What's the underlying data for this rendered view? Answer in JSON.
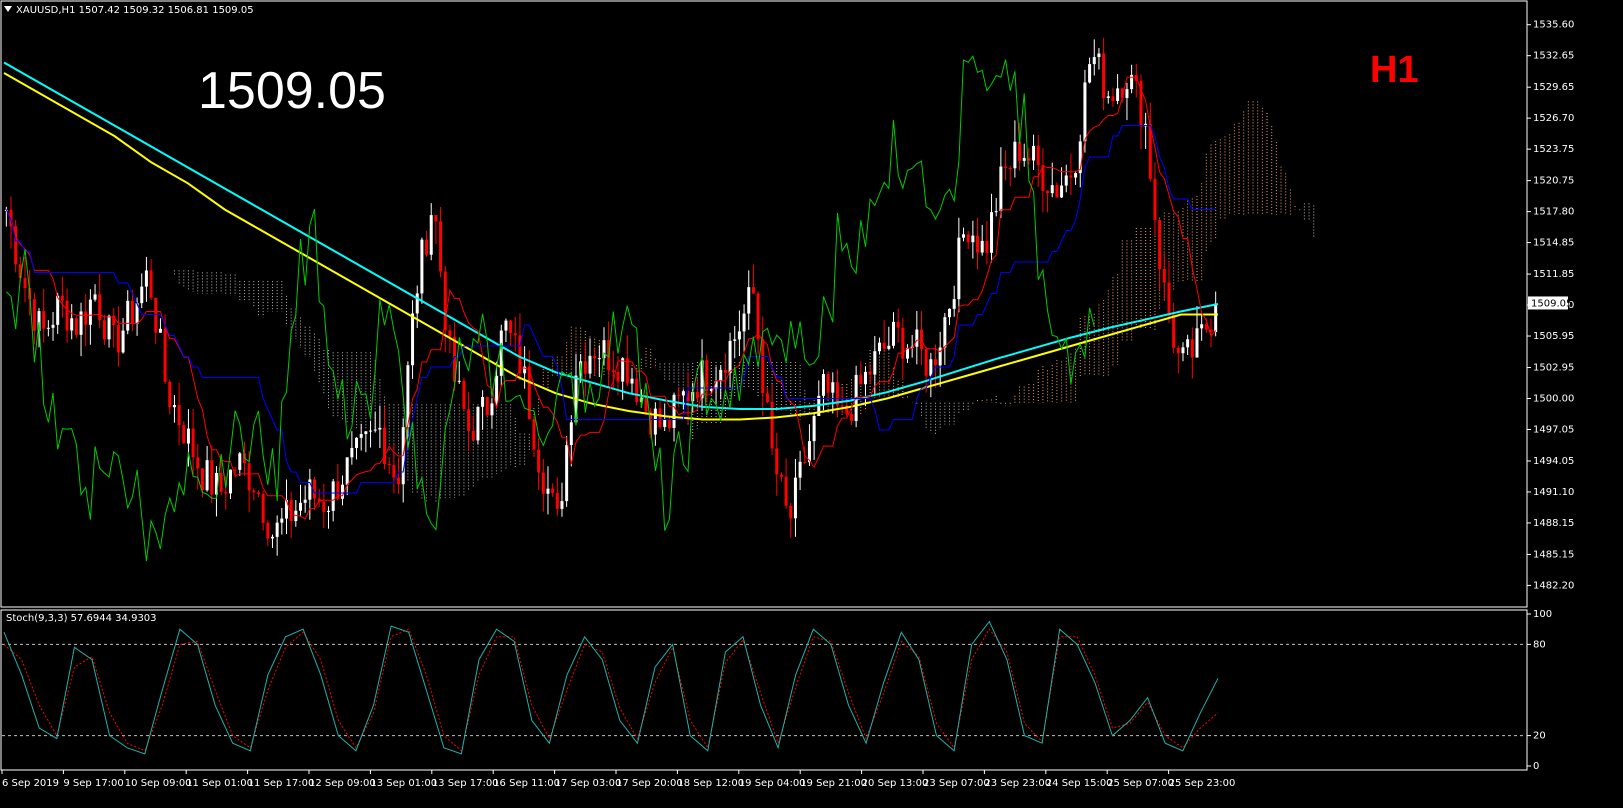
{
  "header": {
    "symbol_info": "XAUUSD,H1  1507.42 1509.32 1506.81 1509.05",
    "big_price": "1509.05",
    "timeframe": "H1"
  },
  "colors": {
    "background": "#000000",
    "grid": "#ffffff",
    "bull": "#ffffff",
    "bear": "#ff0000",
    "ma_fast": "#00ffff",
    "ma_slow": "#ffff00",
    "tenkan": "#ff0000",
    "kijun": "#0000ff",
    "chikou": "#00cc00",
    "cloud": "#f4a460",
    "stoch_main": "#20b2aa",
    "stoch_signal": "#ff0000",
    "level_line": "#c0c0c0"
  },
  "chart_data": [
    {
      "type": "candlestick",
      "symbol": "XAUUSD",
      "timeframe": "H1",
      "last_price": 1509.05,
      "ylim": [
        1481.0,
        1537.0
      ],
      "y_ticks": [
        "1535.60",
        "1532.65",
        "1529.65",
        "1526.70",
        "1523.75",
        "1520.75",
        "1517.80",
        "1514.85",
        "1511.85",
        "1508.90",
        "1505.95",
        "1502.95",
        "1500.00",
        "1497.05",
        "1494.05",
        "1491.10",
        "1488.15",
        "1485.15",
        "1482.20"
      ],
      "x_labels": [
        "6 Sep 2019",
        "9 Sep 17:00",
        "10 Sep 09:00",
        "11 Sep 01:00",
        "11 Sep 17:00",
        "12 Sep 09:00",
        "13 Sep 01:00",
        "13 Sep 17:00",
        "16 Sep 11:00",
        "17 Sep 03:00",
        "17 Sep 20:00",
        "18 Sep 12:00",
        "19 Sep 04:00",
        "19 Sep 21:00",
        "20 Sep 13:00",
        "23 Sep 07:00",
        "23 Sep 23:00",
        "24 Sep 15:00",
        "25 Sep 07:00",
        "25 Sep 23:00"
      ],
      "close_path": [
        1518,
        1511,
        1506,
        1509,
        1507,
        1510,
        1505,
        1508,
        1512,
        1501,
        1497,
        1493,
        1491,
        1494,
        1492,
        1487,
        1489,
        1491,
        1490,
        1493,
        1495,
        1497,
        1492,
        1510,
        1519,
        1503,
        1497,
        1499,
        1507,
        1503,
        1494,
        1488,
        1503,
        1505,
        1504,
        1503,
        1499,
        1497,
        1500,
        1502,
        1503,
        1506,
        1510,
        1495,
        1488,
        1495,
        1501,
        1498,
        1501,
        1504,
        1506,
        1505,
        1503,
        1509,
        1517,
        1514,
        1521,
        1524,
        1522,
        1520,
        1522,
        1533,
        1529,
        1531,
        1527,
        1511,
        1503,
        1505,
        1509.05
      ],
      "series": [
        {
          "name": "Moving Average",
          "values": [
            1532,
            1530,
            1528,
            1526,
            1524,
            1522,
            1520,
            1518,
            1516,
            1514,
            1512,
            1510,
            1508,
            1506,
            1504,
            1502.5,
            1501.5,
            1500.5,
            1499.8,
            1499.2,
            1499,
            1499,
            1499.3,
            1499.8,
            1500.6,
            1501.6,
            1502.7,
            1503.8,
            1504.8,
            1505.8,
            1506.7,
            1507.5,
            1508.3,
            1509
          ]
        },
        {
          "name": "Moving Average",
          "values": [
            1531,
            1529,
            1527,
            1525,
            1522.5,
            1520.5,
            1518,
            1516,
            1514,
            1512,
            1510,
            1508,
            1506,
            1504,
            1502,
            1500.5,
            1499.5,
            1498.8,
            1498.3,
            1498,
            1498,
            1498.2,
            1498.6,
            1499.2,
            1500,
            1501,
            1502,
            1503,
            1504,
            1505,
            1506,
            1507,
            1508,
            1508
          ]
        }
      ]
    },
    {
      "type": "line",
      "indicator": "Stoch(9,3,3)",
      "label": "Stoch(9,3,3) 57.6944 34.9303",
      "main": 57.6944,
      "signal": 34.9303,
      "ylim": [
        0,
        100
      ],
      "levels": [
        20,
        80
      ],
      "y_ticks": [
        "100",
        "80",
        "20",
        "0"
      ],
      "series": [
        {
          "name": "Main",
          "values": [
            88,
            60,
            25,
            18,
            78,
            70,
            20,
            12,
            8,
            50,
            90,
            80,
            40,
            15,
            10,
            60,
            85,
            90,
            60,
            20,
            10,
            40,
            92,
            88,
            50,
            12,
            8,
            70,
            90,
            82,
            30,
            15,
            60,
            85,
            70,
            30,
            15,
            65,
            80,
            20,
            10,
            75,
            85,
            40,
            12,
            60,
            90,
            80,
            40,
            15,
            55,
            88,
            70,
            20,
            10,
            80,
            95,
            70,
            20,
            15,
            90,
            80,
            55,
            20,
            30,
            45,
            15,
            10,
            35,
            57.69
          ]
        },
        {
          "name": "Signal",
          "values": [
            80,
            70,
            40,
            20,
            65,
            72,
            35,
            15,
            10,
            40,
            80,
            82,
            50,
            20,
            12,
            50,
            78,
            88,
            70,
            30,
            12,
            35,
            85,
            90,
            60,
            20,
            10,
            60,
            85,
            85,
            40,
            18,
            50,
            80,
            75,
            38,
            18,
            55,
            78,
            30,
            12,
            68,
            83,
            48,
            15,
            52,
            85,
            82,
            48,
            18,
            48,
            82,
            72,
            28,
            12,
            70,
            90,
            75,
            28,
            16,
            85,
            85,
            60,
            25,
            28,
            42,
            20,
            12,
            25,
            34.93
          ]
        }
      ]
    }
  ]
}
